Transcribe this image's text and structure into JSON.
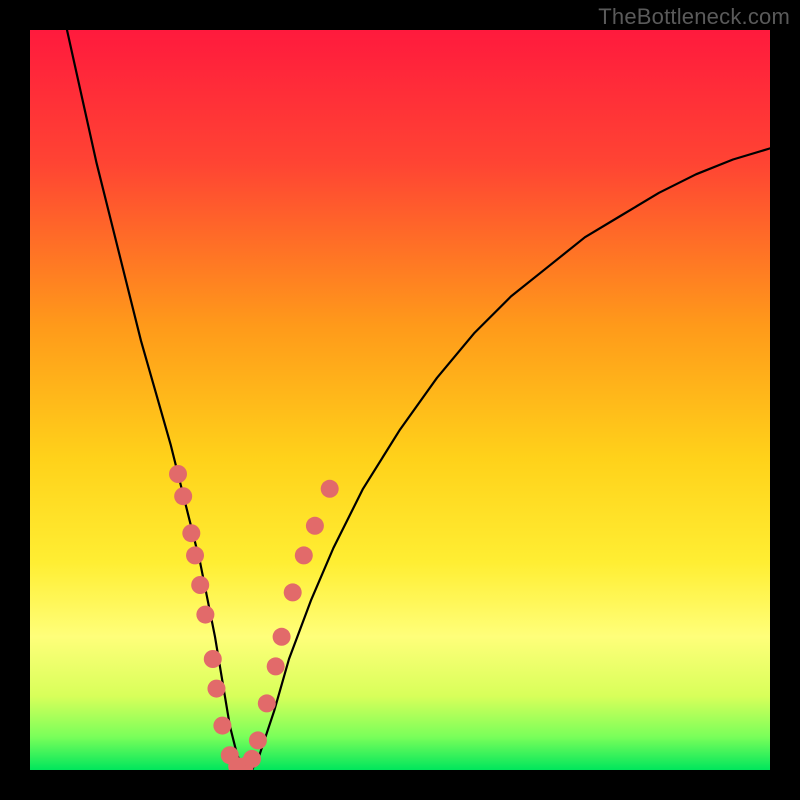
{
  "watermark": "TheBottleneck.com",
  "chart_data": {
    "type": "line",
    "title": "",
    "xlabel": "",
    "ylabel": "",
    "xlim": [
      0,
      100
    ],
    "ylim": [
      0,
      100
    ],
    "grid": false,
    "legend": false,
    "background": {
      "type": "vertical-gradient",
      "stops": [
        {
          "offset": 0.0,
          "color": "#ff1a3d"
        },
        {
          "offset": 0.18,
          "color": "#ff4433"
        },
        {
          "offset": 0.4,
          "color": "#ff9a1a"
        },
        {
          "offset": 0.58,
          "color": "#ffd21a"
        },
        {
          "offset": 0.72,
          "color": "#ffee33"
        },
        {
          "offset": 0.82,
          "color": "#ffff7a"
        },
        {
          "offset": 0.9,
          "color": "#d8ff5a"
        },
        {
          "offset": 0.955,
          "color": "#7aff5a"
        },
        {
          "offset": 1.0,
          "color": "#00e65c"
        }
      ]
    },
    "series": [
      {
        "name": "bottleneck-curve",
        "stroke": "#000000",
        "stroke_width": 2.2,
        "x": [
          5,
          7,
          9,
          11,
          13,
          15,
          17,
          19,
          20,
          21,
          22,
          23,
          24,
          25,
          26,
          27,
          28,
          29,
          30,
          31,
          33,
          35,
          38,
          41,
          45,
          50,
          55,
          60,
          65,
          70,
          75,
          80,
          85,
          90,
          95,
          100
        ],
        "y": [
          100,
          91,
          82,
          74,
          66,
          58,
          51,
          44,
          40,
          36,
          32,
          28,
          23,
          18,
          12,
          6,
          2,
          0,
          0,
          2,
          8,
          15,
          23,
          30,
          38,
          46,
          53,
          59,
          64,
          68,
          72,
          75,
          78,
          80.5,
          82.5,
          84
        ]
      }
    ],
    "markers": {
      "name": "highlight-dots",
      "color": "#e26a6a",
      "radius": 9,
      "points": [
        {
          "x": 20.0,
          "y": 40
        },
        {
          "x": 20.7,
          "y": 37
        },
        {
          "x": 21.8,
          "y": 32
        },
        {
          "x": 22.3,
          "y": 29
        },
        {
          "x": 23.0,
          "y": 25
        },
        {
          "x": 23.7,
          "y": 21
        },
        {
          "x": 24.7,
          "y": 15
        },
        {
          "x": 25.2,
          "y": 11
        },
        {
          "x": 26.0,
          "y": 6
        },
        {
          "x": 27.0,
          "y": 2
        },
        {
          "x": 28.0,
          "y": 0.5
        },
        {
          "x": 29.0,
          "y": 0.5
        },
        {
          "x": 30.0,
          "y": 1.5
        },
        {
          "x": 30.8,
          "y": 4
        },
        {
          "x": 32.0,
          "y": 9
        },
        {
          "x": 33.2,
          "y": 14
        },
        {
          "x": 34.0,
          "y": 18
        },
        {
          "x": 35.5,
          "y": 24
        },
        {
          "x": 37.0,
          "y": 29
        },
        {
          "x": 38.5,
          "y": 33
        },
        {
          "x": 40.5,
          "y": 38
        }
      ]
    }
  }
}
